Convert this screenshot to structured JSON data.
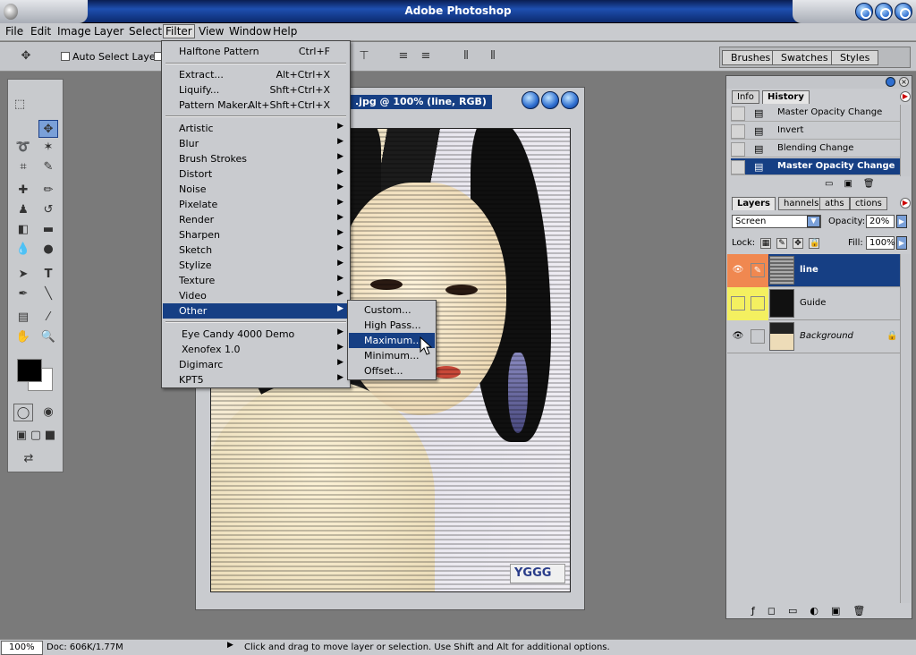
{
  "app": {
    "title": "Adobe Photoshop"
  },
  "menu": {
    "items": [
      "File",
      "Edit",
      "Image",
      "Layer",
      "Select",
      "Filter",
      "View",
      "Window",
      "Help"
    ]
  },
  "options": {
    "auto_select_label": "Auto Select Layer"
  },
  "palette_well": {
    "tabs": [
      "Brushes",
      "Swatches",
      "Styles"
    ]
  },
  "document": {
    "title": ".jpg @ 100% (line, RGB)",
    "watermark": "YGGG"
  },
  "filter_menu": {
    "group1": [
      {
        "label": "Halftone Pattern",
        "shortcut": "Ctrl+F"
      }
    ],
    "group2": [
      {
        "label": "Extract...",
        "shortcut": "Alt+Ctrl+X"
      },
      {
        "label": "Liquify...",
        "shortcut": "Shft+Ctrl+X"
      },
      {
        "label": "Pattern Maker...",
        "shortcut": "Alt+Shft+Ctrl+X"
      }
    ],
    "group3": [
      "Artistic",
      "Blur",
      "Brush Strokes",
      "Distort",
      "Noise",
      "Pixelate",
      "Render",
      "Sharpen",
      "Sketch",
      "Stylize",
      "Texture",
      "Video",
      "Other"
    ],
    "group4": [
      "Eye Candy 4000 Demo",
      "Xenofex 1.0",
      "Digimarc",
      "KPT5"
    ]
  },
  "other_submenu": [
    "Custom...",
    "High Pass...",
    "Maximum...",
    "Minimum...",
    "Offset..."
  ],
  "history_palette": {
    "tabs": [
      "Info",
      "History"
    ],
    "items": [
      "Master Opacity Change",
      "Invert",
      "Blending Change",
      "Master Opacity Change"
    ]
  },
  "layers_palette": {
    "tabs": [
      "Layers",
      "Channels",
      "Paths",
      "Actions"
    ],
    "tab_visible": [
      "Layers",
      "hannels",
      "aths",
      "ctions"
    ],
    "blend_mode": "Screen",
    "opacity_label": "Opacity:",
    "opacity_value": "20%",
    "lock_label": "Lock:",
    "fill_label": "Fill:",
    "fill_value": "100%",
    "layers": [
      "line",
      "Guide",
      "Background"
    ]
  },
  "status": {
    "zoom": "100%",
    "doc_size": "Doc: 606K/1.77M",
    "hint": "Click and drag to move layer or selection.  Use Shift and Alt for additional options."
  }
}
